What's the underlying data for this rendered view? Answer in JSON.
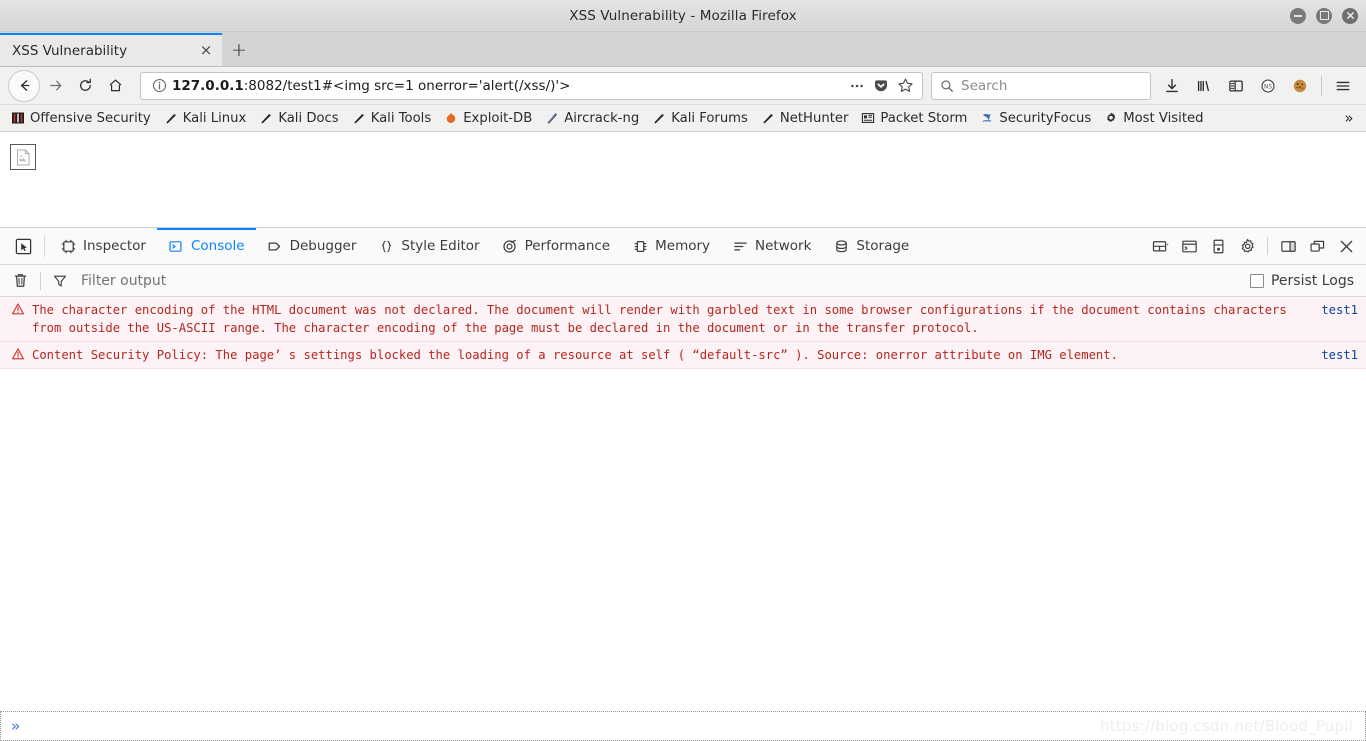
{
  "window": {
    "title": "XSS Vulnerability - Mozilla Firefox",
    "minimize_label": "Minimize",
    "maximize_label": "Maximize",
    "close_label": "Close"
  },
  "tabs": {
    "items": [
      {
        "title": "XSS Vulnerability",
        "close_label": "×"
      }
    ],
    "new_tab_label": "+"
  },
  "navigation": {
    "back_label": "Back",
    "forward_label": "Forward",
    "reload_label": "Reload",
    "home_label": "Home"
  },
  "urlbar": {
    "host": "127.0.0.1",
    "rest": ":8082/test1#<img src=1 onerror='alert(/xss/)'>",
    "full_url": "127.0.0.1:8082/test1#<img src=1 onerror='alert(/xss/)'>",
    "identity_icon": "info-circle-icon",
    "page_actions_icon": "ellipsis-icon",
    "pocket_icon": "pocket-icon",
    "bookmark_icon": "star-icon"
  },
  "search": {
    "placeholder": "Search",
    "icon": "search-icon"
  },
  "toolbar_right": {
    "items": [
      {
        "name": "downloads-icon",
        "label": "Downloads"
      },
      {
        "name": "library-icon",
        "label": "Library"
      },
      {
        "name": "sidebar-icon",
        "label": "Sidebars"
      },
      {
        "name": "noscript-icon",
        "label": "NoScript"
      },
      {
        "name": "cookie-icon",
        "label": "Cookie Manager"
      },
      {
        "name": "hamburger-menu-icon",
        "label": "Open menu"
      }
    ]
  },
  "bookmarks": {
    "items": [
      {
        "label": "Offensive Security",
        "icon": "offsec-icon"
      },
      {
        "label": "Kali Linux",
        "icon": "kali-dragon-icon"
      },
      {
        "label": "Kali Docs",
        "icon": "kali-dragon-icon"
      },
      {
        "label": "Kali Tools",
        "icon": "kali-dragon-icon"
      },
      {
        "label": "Exploit-DB",
        "icon": "exploitdb-icon"
      },
      {
        "label": "Aircrack-ng",
        "icon": "aircrack-icon"
      },
      {
        "label": "Kali Forums",
        "icon": "kali-dragon-icon"
      },
      {
        "label": "NetHunter",
        "icon": "kali-dragon-icon"
      },
      {
        "label": "Packet Storm",
        "icon": "packetstorm-icon"
      },
      {
        "label": "SecurityFocus",
        "icon": "securityfocus-icon"
      },
      {
        "label": "Most Visited",
        "icon": "gear-icon"
      }
    ],
    "overflow_label": "»"
  },
  "page": {
    "broken_image_alt": "broken-image-placeholder"
  },
  "devtools": {
    "picker_icon": "element-picker-icon",
    "tabs": [
      {
        "label": "Inspector",
        "icon": "inspector-icon",
        "active": false
      },
      {
        "label": "Console",
        "icon": "console-icon",
        "active": true
      },
      {
        "label": "Debugger",
        "icon": "debugger-icon",
        "active": false
      },
      {
        "label": "Style Editor",
        "icon": "style-editor-icon",
        "active": false
      },
      {
        "label": "Performance",
        "icon": "performance-icon",
        "active": false
      },
      {
        "label": "Memory",
        "icon": "memory-icon",
        "active": false
      },
      {
        "label": "Network",
        "icon": "network-icon",
        "active": false
      },
      {
        "label": "Storage",
        "icon": "storage-icon",
        "active": false
      }
    ],
    "right_icons": [
      {
        "name": "responsive-design-mode-icon",
        "label": "Responsive Design Mode"
      },
      {
        "name": "split-console-icon",
        "label": "Split console"
      },
      {
        "name": "screenshot-icon",
        "label": "Take a screenshot"
      },
      {
        "name": "devtools-settings-gear-icon",
        "label": "Settings"
      },
      {
        "name": "dock-side-icon",
        "label": "Dock to side"
      },
      {
        "name": "separate-window-icon",
        "label": "Separate window"
      },
      {
        "name": "close-devtools-icon",
        "label": "Close DevTools"
      }
    ],
    "filter": {
      "trash_icon": "trash-icon",
      "funnel_icon": "funnel-icon",
      "placeholder": "Filter output",
      "persist_label": "Persist Logs",
      "persist_checked": false
    },
    "console": {
      "rows": [
        {
          "level": "error",
          "icon": "error-triangle-icon",
          "message": "The character encoding of the HTML document was not declared. The document will render with garbled text in some browser configurations if the document contains characters from outside the US-ASCII range. The character encoding of the page must be declared in the document or in the transfer protocol.",
          "source": "test1"
        },
        {
          "level": "error",
          "icon": "error-triangle-icon",
          "message": "Content Security Policy: The page’ s settings blocked the loading of a resource at self ( “default-src” ). Source: onerror attribute on IMG element.",
          "source": "test1"
        }
      ],
      "prompt": "»",
      "input_value": ""
    }
  },
  "watermark": {
    "text": "https://blog.csdn.net/Blood_Pupil"
  },
  "colors": {
    "accent": "#0a84ff",
    "error_text": "#b3281e",
    "error_bg": "#fdf2f5",
    "link": "#0b46a0",
    "chrome_bg": "#f1f1f0"
  }
}
